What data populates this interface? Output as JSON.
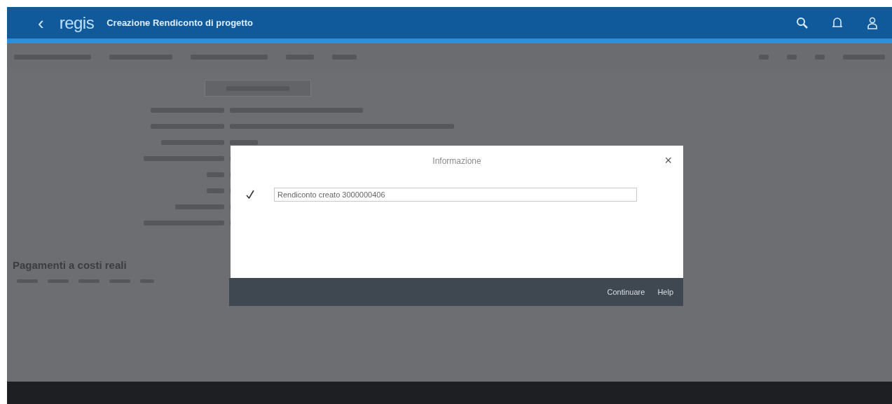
{
  "app": {
    "back": "‹",
    "logo": "regis",
    "title": "Creazione Rendiconto di progetto"
  },
  "dialog": {
    "title": "Informazione",
    "close": "×",
    "messages": [
      {
        "kind": "success",
        "text": "Rendiconto creato 3000000406"
      }
    ],
    "buttons": [
      "Continuare",
      "Help"
    ]
  },
  "section": {
    "title": "Pagamenti a costi reali"
  }
}
